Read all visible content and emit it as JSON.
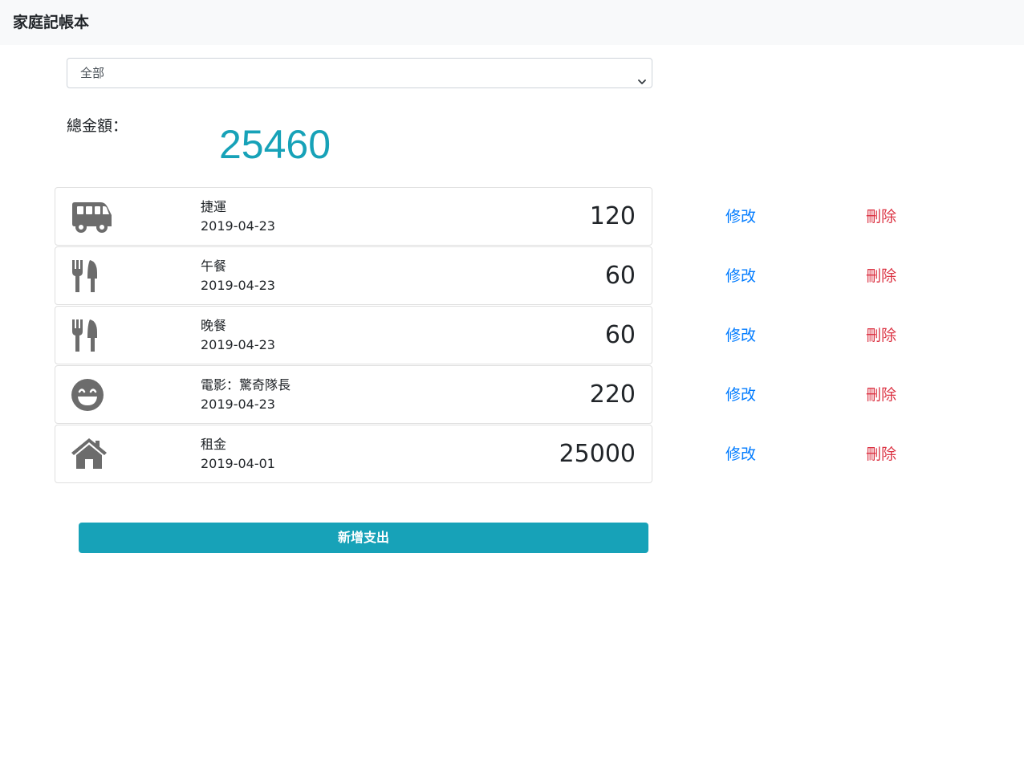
{
  "navbar": {
    "brand": "家庭記帳本"
  },
  "filter": {
    "selected": "全部"
  },
  "summary": {
    "label": "總金額：",
    "total": "25460"
  },
  "expenses": [
    {
      "icon": "bus-icon",
      "name": "捷運",
      "date": "2019-04-23",
      "amount": "120",
      "edit": "修改",
      "delete": "刪除"
    },
    {
      "icon": "utensils-icon",
      "name": "午餐",
      "date": "2019-04-23",
      "amount": "60",
      "edit": "修改",
      "delete": "刪除"
    },
    {
      "icon": "utensils-icon",
      "name": "晚餐",
      "date": "2019-04-23",
      "amount": "60",
      "edit": "修改",
      "delete": "刪除"
    },
    {
      "icon": "smile-icon",
      "name": "電影：驚奇隊長",
      "date": "2019-04-23",
      "amount": "220",
      "edit": "修改",
      "delete": "刪除"
    },
    {
      "icon": "home-icon",
      "name": "租金",
      "date": "2019-04-01",
      "amount": "25000",
      "edit": "修改",
      "delete": "刪除"
    }
  ],
  "add_button": {
    "label": "新增支出"
  },
  "colors": {
    "accent": "#17a2b8",
    "edit": "#007bff",
    "delete": "#dc3545",
    "icon": "#6c6c6c",
    "navbar": "#f8f9fa"
  }
}
